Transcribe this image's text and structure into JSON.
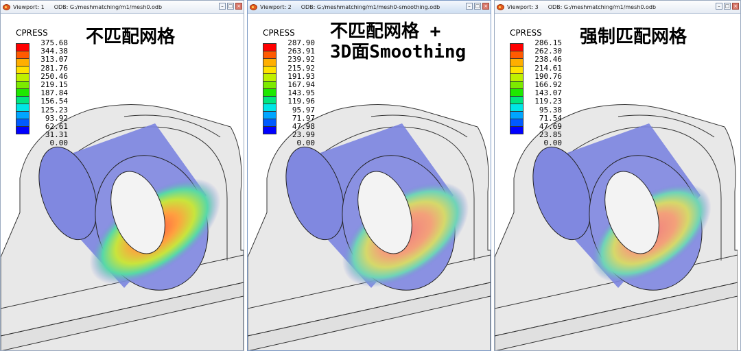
{
  "legend_colors": [
    "#ff0000",
    "#ff5a00",
    "#ffae00",
    "#ffe100",
    "#bff000",
    "#7dea00",
    "#1ee800",
    "#00e680",
    "#00e6e6",
    "#00a5ff",
    "#005bff",
    "#0000ff"
  ],
  "viewports": [
    {
      "name": "Viewport: 1",
      "odb": "ODB: G:/meshmatching/m1/mesh0.odb",
      "legend_title": "CPRESS",
      "ticks": [
        "375.68",
        "344.38",
        "313.07",
        "281.76",
        "250.46",
        "219.15",
        "187.84",
        "156.54",
        "125.23",
        "93.92",
        "62.61",
        "31.31",
        "0.00"
      ],
      "heading_lines": [
        "不匹配网格"
      ]
    },
    {
      "name": "Viewport: 2",
      "odb": "ODB: G:/meshmatching/m1/mesh0-smoothing.odb",
      "legend_title": "CPRESS",
      "ticks": [
        "287.90",
        "263.91",
        "239.92",
        "215.92",
        "191.93",
        "167.94",
        "143.95",
        "119.96",
        "95.97",
        "71.97",
        "47.98",
        "23.99",
        "0.00"
      ],
      "heading_lines": [
        "不匹配网格 +",
        "3D面Smoothing"
      ]
    },
    {
      "name": "Viewport: 3",
      "odb": "ODB: G:/meshmatching/m1/mesh0.odb",
      "legend_title": "CPRESS",
      "ticks": [
        "286.15",
        "262.30",
        "238.46",
        "214.61",
        "190.76",
        "166.92",
        "143.07",
        "119.23",
        "95.38",
        "71.54",
        "47.69",
        "23.85",
        "0.00"
      ],
      "heading_lines": [
        "强制匹配网格"
      ]
    }
  ]
}
